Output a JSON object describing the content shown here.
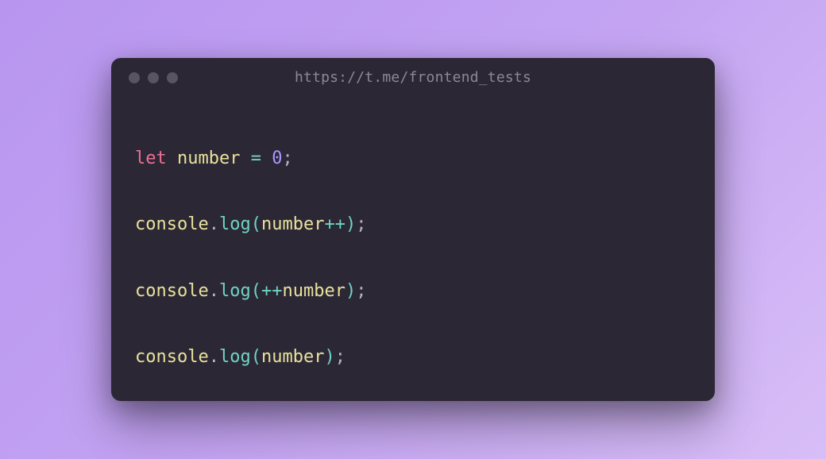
{
  "window": {
    "title": "https://t.me/frontend_tests"
  },
  "code": {
    "line1": {
      "kw": "let",
      "sp1": " ",
      "id": "number",
      "sp2": " ",
      "op_eq": "=",
      "sp3": " ",
      "num": "0",
      "semi": ";"
    },
    "line2": {
      "obj": "console",
      "dot": ".",
      "meth": "log",
      "lpar": "(",
      "arg": "number",
      "inc": "++",
      "rpar": ")",
      "semi": ";"
    },
    "line3": {
      "obj": "console",
      "dot": ".",
      "meth": "log",
      "lpar": "(",
      "inc": "++",
      "arg": "number",
      "rpar": ")",
      "semi": ";"
    },
    "line4": {
      "obj": "console",
      "dot": ".",
      "meth": "log",
      "lpar": "(",
      "arg": "number",
      "rpar": ")",
      "semi": ";"
    }
  }
}
